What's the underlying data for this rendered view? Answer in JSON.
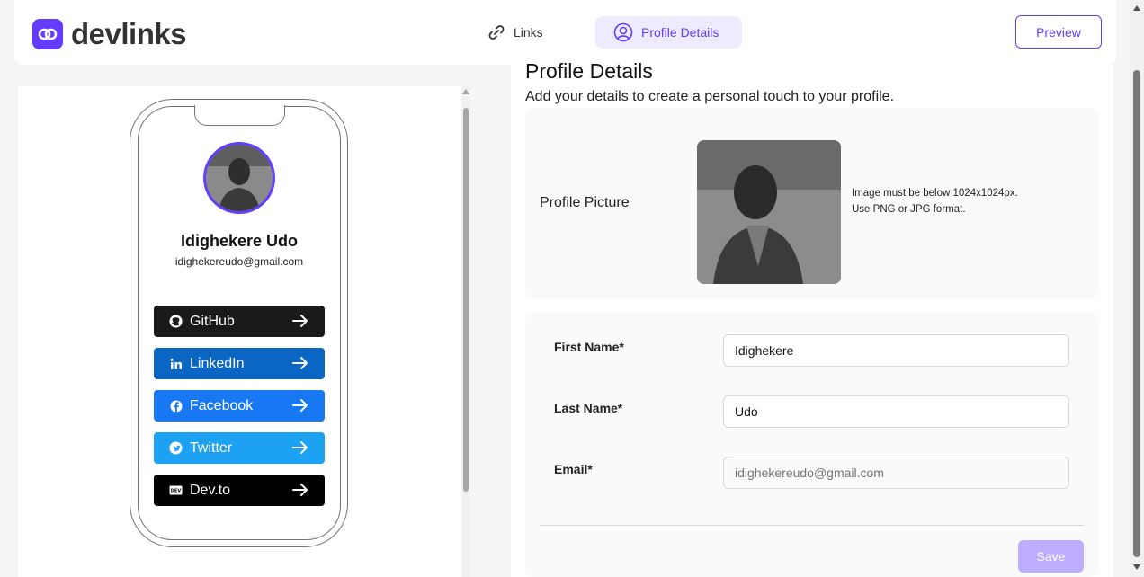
{
  "brand": {
    "name": "devlinks",
    "color": "#633cff"
  },
  "nav": {
    "links_label": "Links",
    "profile_label": "Profile Details",
    "preview_label": "Preview"
  },
  "preview": {
    "name": "Idighekere Udo",
    "email": "idighekereudo@gmail.com",
    "links": [
      {
        "platform": "GitHub",
        "color": "#1a1a1a",
        "icon": "github-icon"
      },
      {
        "platform": "LinkedIn",
        "color": "#0a66c2",
        "icon": "linkedin-icon"
      },
      {
        "platform": "Facebook",
        "color": "#1877f2",
        "icon": "facebook-icon"
      },
      {
        "platform": "Twitter",
        "color": "#1da1f2",
        "icon": "twitter-icon"
      },
      {
        "platform": "Dev.to",
        "color": "#000000",
        "icon": "devto-icon"
      }
    ]
  },
  "main": {
    "title": "Profile Details",
    "subtitle": "Add your details to create a personal touch to your profile.",
    "picture_label": "Profile Picture",
    "picture_note": "Image must be below 1024x1024px. Use PNG or JPG format.",
    "form": {
      "first_name_label": "First Name*",
      "first_name_value": "Idighekere",
      "last_name_label": "Last Name*",
      "last_name_value": "Udo",
      "email_label": "Email*",
      "email_placeholder": "idighekereudo@gmail.com",
      "save_label": "Save"
    }
  }
}
